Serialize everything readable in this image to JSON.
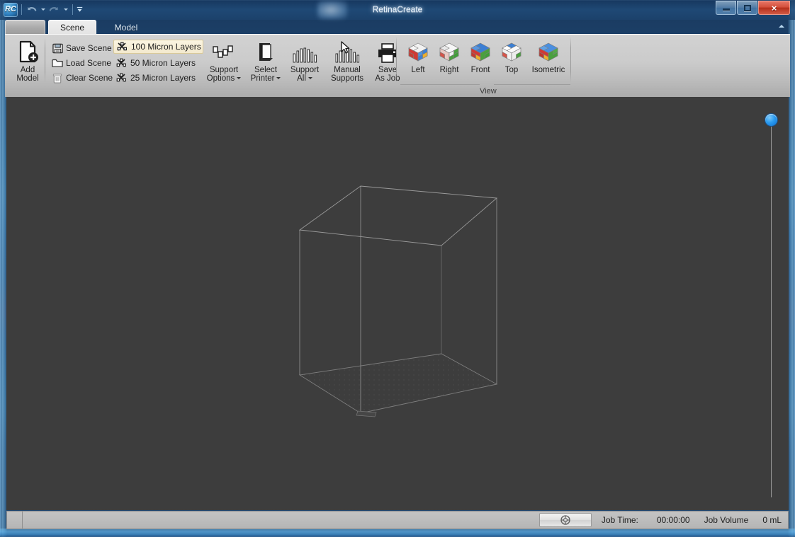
{
  "window": {
    "title": "RetinaCreate",
    "logo_text": "RC",
    "logo_icon": "app-logo-icon",
    "minimize_label": "minimize-icon",
    "maximize_label": "maximize-icon",
    "close_label": "×",
    "collapse_ribbon_icon": "chevron-up-icon"
  },
  "quick_access": {
    "items": [
      {
        "name": "undo-button",
        "icon": "undo-arrow-icon"
      },
      {
        "name": "undo-dropdown",
        "icon": "chevron-down-icon"
      },
      {
        "name": "redo-button",
        "icon": "redo-arrow-icon"
      },
      {
        "name": "redo-dropdown",
        "icon": "chevron-down-icon"
      },
      {
        "name": "customize-quick-access-toolbar",
        "icon": "chevron-down-bar-icon"
      }
    ]
  },
  "tabs": [
    {
      "label": "",
      "name": "tab-blank",
      "active": false
    },
    {
      "label": "Scene",
      "name": "tab-scene",
      "active": true
    },
    {
      "label": "Model",
      "name": "tab-model",
      "active": false
    }
  ],
  "ribbon": {
    "add_model": {
      "label_line1": "Add",
      "label_line2": "Model",
      "icon": "add-model-icon"
    },
    "scene_commands": [
      {
        "label": "Save Scene",
        "icon": "save-icon",
        "selected": false
      },
      {
        "label": "Load Scene",
        "icon": "folder-icon",
        "selected": false
      },
      {
        "label": "Clear Scene",
        "icon": "trash-icon",
        "selected": false
      }
    ],
    "layer_commands": [
      {
        "label": "100 Micron Layers",
        "icon": "layers-icon",
        "selected": true
      },
      {
        "label": "50 Micron Layers",
        "icon": "layers-icon",
        "selected": false
      },
      {
        "label": "25 Micron Layers",
        "icon": "layers-icon",
        "selected": false
      }
    ],
    "tools": [
      {
        "label_line1": "Support",
        "label_line2": "Options",
        "icon": "sliders-icon",
        "dropdown": true
      },
      {
        "label_line1": "Select",
        "label_line2": "Printer",
        "icon": "printer-box-icon",
        "dropdown": true
      },
      {
        "label_line1": "Support",
        "label_line2": "All",
        "icon": "supports-icon",
        "dropdown": true
      },
      {
        "label_line1": "Manual",
        "label_line2": "Supports",
        "icon": "cursor-supports-icon",
        "dropdown": false
      },
      {
        "label_line1": "Save",
        "label_line2": "As Job",
        "icon": "printer-icon",
        "dropdown": false
      }
    ],
    "view_group": {
      "label": "View",
      "items": [
        {
          "label": "Left",
          "icon": "viewcube-left-icon"
        },
        {
          "label": "Right",
          "icon": "viewcube-right-icon"
        },
        {
          "label": "Front",
          "icon": "viewcube-front-icon"
        },
        {
          "label": "Top",
          "icon": "viewcube-top-icon"
        },
        {
          "label": "Isometric",
          "icon": "viewcube-isometric-icon"
        }
      ]
    }
  },
  "viewport": {
    "name": "3d-viewport",
    "background_color": "#3d3d3d",
    "build_volume_edge_color": "#8a8a8a",
    "grid_color": "#4f4f4f",
    "slider": {
      "name": "zoom-slider",
      "handle_color": "#2a9bf0",
      "value_position": "top"
    }
  },
  "statusbar": {
    "spin_icon": "rotate-icon",
    "job_time_label": "Job Time:",
    "job_time_value": "00:00:00",
    "job_volume_label": "Job Volume",
    "job_volume_value": "0 mL"
  }
}
